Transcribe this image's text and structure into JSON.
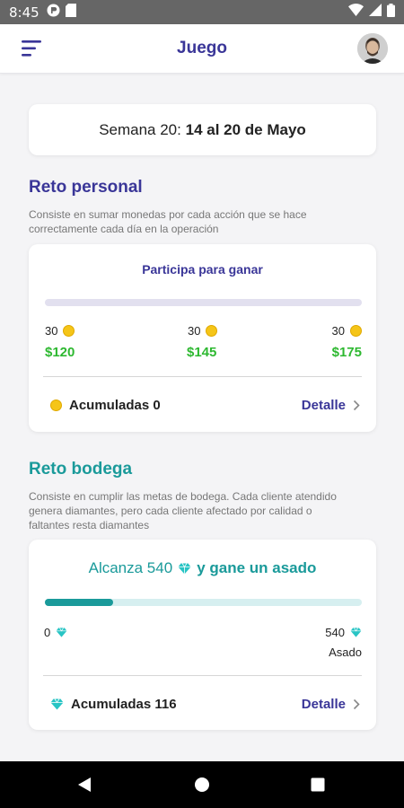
{
  "status_bar": {
    "time": "8:45"
  },
  "app_bar": {
    "title": "Juego"
  },
  "week": {
    "prefix": "Semana 20:",
    "range": "14 al 20 de Mayo"
  },
  "personal": {
    "title": "Reto personal",
    "description": "Consiste en sumar monedas por cada acción que se hace correctamente cada día en la operación",
    "card_title": "Participa para ganar",
    "progress": 0,
    "milestones": [
      {
        "coins": "30",
        "prize": "$120"
      },
      {
        "coins": "30",
        "prize": "$145"
      },
      {
        "coins": "30",
        "prize": "$175"
      }
    ],
    "accumulated_label": "Acumuladas 0",
    "detail_label": "Detalle"
  },
  "bodega": {
    "title": "Reto bodega",
    "description": "Consiste en cumplir las metas de bodega. Cada cliente atendido genera diamantes, pero cada cliente afectado por calidad o faltantes resta diamantes",
    "goal_prefix": "Alcanza 540",
    "goal_suffix": "y gane un asado",
    "progress": 0.215,
    "start_value": "0",
    "end_value": "540",
    "end_caption": "Asado",
    "accumulated_label": "Acumuladas 116",
    "detail_label": "Detalle"
  },
  "colors": {
    "primary": "#3a3698",
    "teal": "#1a9a9a",
    "prize_green": "#2db830",
    "coin": "#f5c518",
    "diamond": "#28c4c4",
    "track_purple": "#e2e0ef",
    "track_teal": "#d6eff0"
  },
  "icons": {
    "menu": "hamburger-menu-icon",
    "avatar": "user-avatar",
    "coin": "coin-icon",
    "diamond": "diamond-icon",
    "chevron": "chevron-right-icon",
    "back": "nav-back-icon",
    "home": "nav-home-icon",
    "recents": "nav-recents-icon"
  }
}
